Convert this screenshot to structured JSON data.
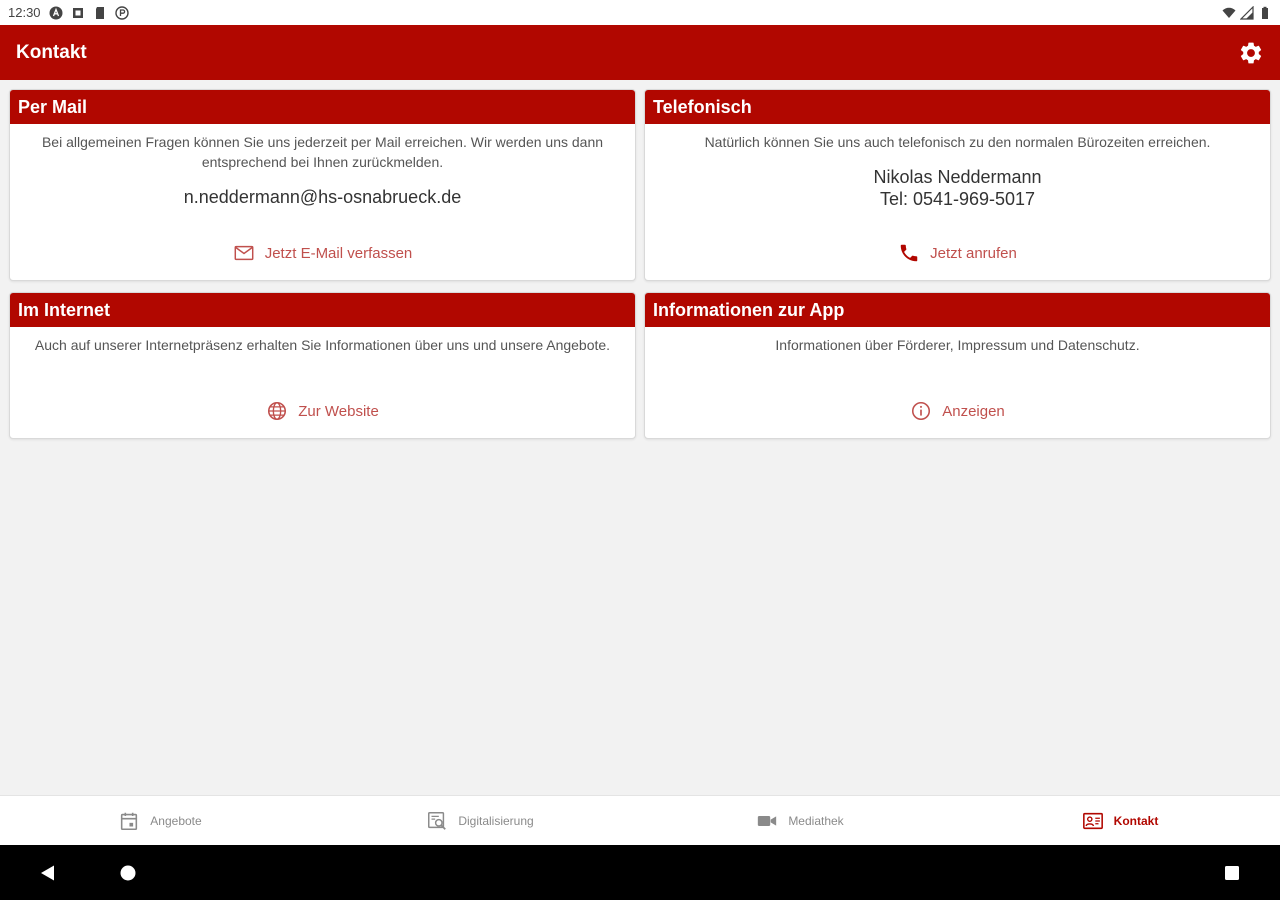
{
  "status_bar": {
    "time": "12:30"
  },
  "app_bar": {
    "title": "Kontakt"
  },
  "cards": {
    "mail": {
      "title": "Per Mail",
      "description": "Bei allgemeinen Fragen können Sie uns jederzeit per Mail erreichen. Wir werden uns dann entsprechend bei Ihnen zurückmelden.",
      "email": "n.neddermann@hs-osnabrueck.de",
      "action_label": "Jetzt E-Mail verfassen"
    },
    "phone": {
      "title": "Telefonisch",
      "description": "Natürlich können Sie uns auch telefonisch zu den normalen Bürozeiten erreichen.",
      "name": "Nikolas Neddermann",
      "phone": "Tel: 0541-969-5017",
      "action_label": "Jetzt anrufen"
    },
    "web": {
      "title": "Im Internet",
      "description": "Auch auf unserer Internetpräsenz erhalten Sie Informationen über uns und unsere Angebote.",
      "action_label": "Zur Website"
    },
    "info": {
      "title": "Informationen zur App",
      "description": "Informationen über Förderer, Impressum und Datenschutz.",
      "action_label": "Anzeigen"
    }
  },
  "bottom_nav": {
    "items": [
      {
        "label": "Angebote",
        "icon": "calendar-icon"
      },
      {
        "label": "Digitalisierung",
        "icon": "digital-search-icon"
      },
      {
        "label": "Mediathek",
        "icon": "video-camera-icon"
      },
      {
        "label": "Kontakt",
        "icon": "contact-card-icon",
        "active": true
      }
    ]
  },
  "colors": {
    "primary": "#b10700",
    "action": "#c0504d",
    "background": "#f2f2f2"
  }
}
